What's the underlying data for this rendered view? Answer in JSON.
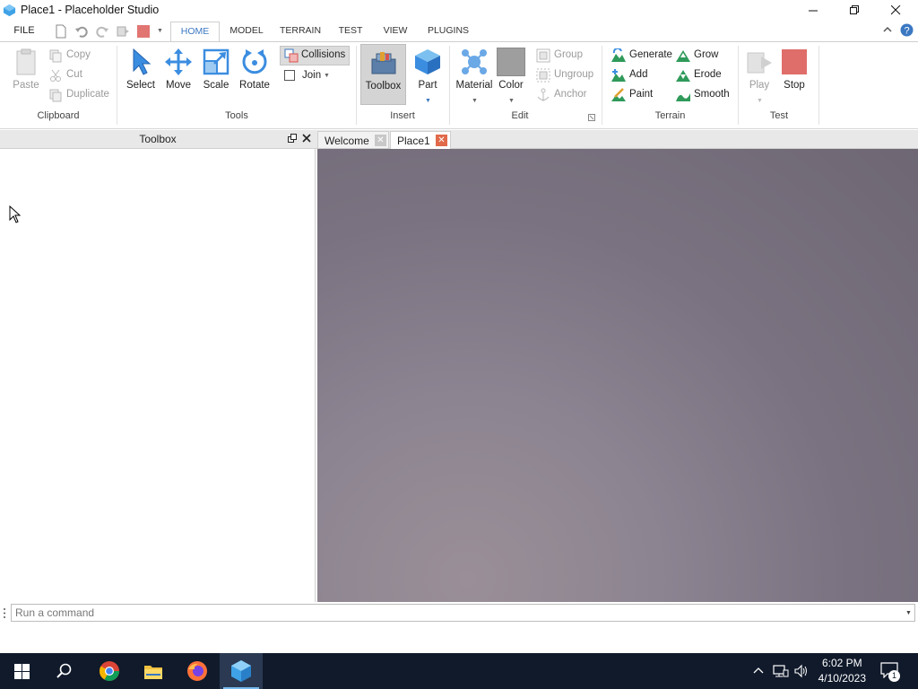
{
  "window": {
    "title": "Place1 - Placeholder Studio",
    "controls": {
      "minimize": "minimize",
      "maximize": "restore",
      "close": "close"
    }
  },
  "ribbon_tabs": {
    "file": "FILE",
    "tabs": [
      "HOME",
      "MODEL",
      "TERRAIN",
      "TEST",
      "VIEW",
      "PLUGINS"
    ],
    "active": "HOME"
  },
  "ribbon": {
    "clipboard": {
      "label": "Clipboard",
      "paste": "Paste",
      "copy": "Copy",
      "cut": "Cut",
      "duplicate": "Duplicate"
    },
    "tools": {
      "label": "Tools",
      "select": "Select",
      "move": "Move",
      "scale": "Scale",
      "rotate": "Rotate",
      "collisions": "Collisions",
      "join": "Join"
    },
    "insert": {
      "label": "Insert",
      "toolbox": "Toolbox",
      "part": "Part"
    },
    "edit": {
      "label": "Edit",
      "material": "Material",
      "color": "Color",
      "group": "Group",
      "ungroup": "Ungroup",
      "anchor": "Anchor"
    },
    "terrain": {
      "label": "Terrain",
      "generate": "Generate",
      "add": "Add",
      "paint": "Paint",
      "grow": "Grow",
      "erode": "Erode",
      "smooth": "Smooth"
    },
    "test": {
      "label": "Test",
      "play": "Play",
      "stop": "Stop"
    }
  },
  "panels": {
    "toolbox_title": "Toolbox",
    "doc_tabs": [
      "Welcome",
      "Place1"
    ]
  },
  "command_bar": {
    "placeholder": "Run a command"
  },
  "taskbar": {
    "time": "6:02 PM",
    "date": "4/10/2023",
    "notification_count": "1"
  },
  "colors": {
    "accent": "#3b78c2",
    "stop_red": "#d9534f",
    "color_swatch": "#9e9e9e",
    "viewport": "#7a7280",
    "taskbar": "#101a2b"
  }
}
